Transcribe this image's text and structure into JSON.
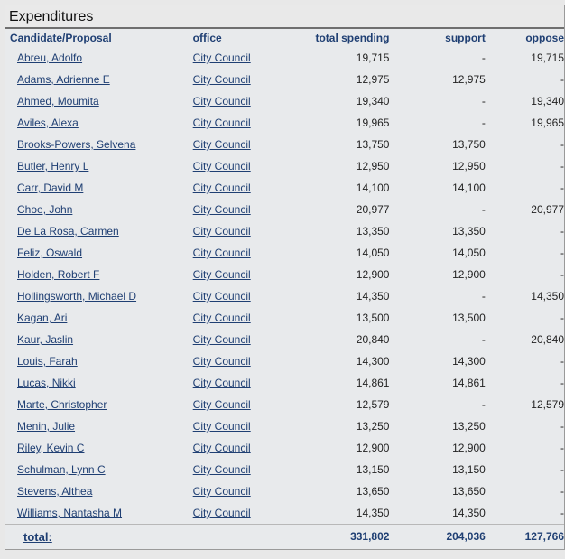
{
  "panel": {
    "title": "Expenditures"
  },
  "table": {
    "headers": {
      "name": "Candidate/Proposal",
      "office": "office",
      "total": "total spending",
      "support": "support",
      "oppose": "oppose"
    },
    "rows": [
      {
        "name": "Abreu, Adolfo",
        "office": "City Council",
        "total": "19,715",
        "support": "-",
        "oppose": "19,715"
      },
      {
        "name": "Adams, Adrienne E",
        "office": "City Council",
        "total": "12,975",
        "support": "12,975",
        "oppose": "-"
      },
      {
        "name": "Ahmed, Moumita",
        "office": "City Council",
        "total": "19,340",
        "support": "-",
        "oppose": "19,340"
      },
      {
        "name": "Aviles, Alexa",
        "office": "City Council",
        "total": "19,965",
        "support": "-",
        "oppose": "19,965"
      },
      {
        "name": "Brooks-Powers, Selvena",
        "office": "City Council",
        "total": "13,750",
        "support": "13,750",
        "oppose": "-"
      },
      {
        "name": "Butler, Henry L",
        "office": "City Council",
        "total": "12,950",
        "support": "12,950",
        "oppose": "-"
      },
      {
        "name": "Carr, David M",
        "office": "City Council",
        "total": "14,100",
        "support": "14,100",
        "oppose": "-"
      },
      {
        "name": "Choe, John",
        "office": "City Council",
        "total": "20,977",
        "support": "-",
        "oppose": "20,977"
      },
      {
        "name": "De La Rosa, Carmen",
        "office": "City Council",
        "total": "13,350",
        "support": "13,350",
        "oppose": "-"
      },
      {
        "name": "Feliz, Oswald",
        "office": "City Council",
        "total": "14,050",
        "support": "14,050",
        "oppose": "-"
      },
      {
        "name": "Holden, Robert F",
        "office": "City Council",
        "total": "12,900",
        "support": "12,900",
        "oppose": "-"
      },
      {
        "name": "Hollingsworth, Michael D",
        "office": "City Council",
        "total": "14,350",
        "support": "-",
        "oppose": "14,350"
      },
      {
        "name": "Kagan, Ari",
        "office": "City Council",
        "total": "13,500",
        "support": "13,500",
        "oppose": "-"
      },
      {
        "name": "Kaur, Jaslin",
        "office": "City Council",
        "total": "20,840",
        "support": "-",
        "oppose": "20,840"
      },
      {
        "name": "Louis, Farah",
        "office": "City Council",
        "total": "14,300",
        "support": "14,300",
        "oppose": "-"
      },
      {
        "name": "Lucas, Nikki",
        "office": "City Council",
        "total": "14,861",
        "support": "14,861",
        "oppose": "-"
      },
      {
        "name": "Marte, Christopher",
        "office": "City Council",
        "total": "12,579",
        "support": "-",
        "oppose": "12,579"
      },
      {
        "name": "Menin, Julie",
        "office": "City Council",
        "total": "13,250",
        "support": "13,250",
        "oppose": "-"
      },
      {
        "name": "Riley, Kevin C",
        "office": "City Council",
        "total": "12,900",
        "support": "12,900",
        "oppose": "-"
      },
      {
        "name": "Schulman, Lynn C",
        "office": "City Council",
        "total": "13,150",
        "support": "13,150",
        "oppose": "-"
      },
      {
        "name": "Stevens, Althea",
        "office": "City Council",
        "total": "13,650",
        "support": "13,650",
        "oppose": "-"
      },
      {
        "name": "Williams, Nantasha M",
        "office": "City Council",
        "total": "14,350",
        "support": "14,350",
        "oppose": "-"
      }
    ],
    "totals": {
      "label": "total:",
      "total": "331,802",
      "support": "204,036",
      "oppose": "127,766"
    }
  }
}
